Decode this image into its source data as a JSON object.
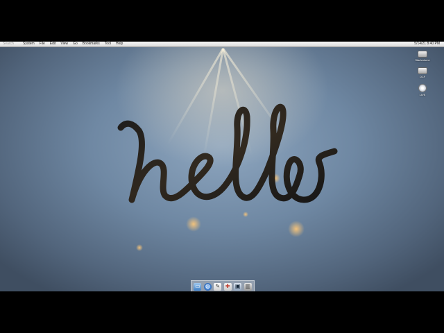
{
  "menubar": {
    "search_placeholder": "Search",
    "items": [
      "System",
      "File",
      "Edit",
      "View",
      "Go",
      "Bookmarks",
      "Tool",
      "Help"
    ],
    "clock": "5/14/21 8:40 PM"
  },
  "desktop": {
    "icons": [
      {
        "label": "Startvolume",
        "icon": "hard-drive-icon"
      },
      {
        "label": "OCF",
        "icon": "hard-drive-icon"
      },
      {
        "label": "LIVE",
        "icon": "optical-disc-icon"
      }
    ],
    "wallpaper_text": "hello",
    "colors": {
      "accent": "#f5a623",
      "sky": "#6f88a3"
    }
  },
  "dock": {
    "items": [
      {
        "icon": "finder-folder-icon"
      },
      {
        "icon": "globe-browser-icon"
      },
      {
        "icon": "text-editor-icon"
      },
      {
        "icon": "system-tool-icon"
      },
      {
        "icon": "terminal-window-icon"
      },
      {
        "icon": "trash-icon"
      }
    ]
  }
}
